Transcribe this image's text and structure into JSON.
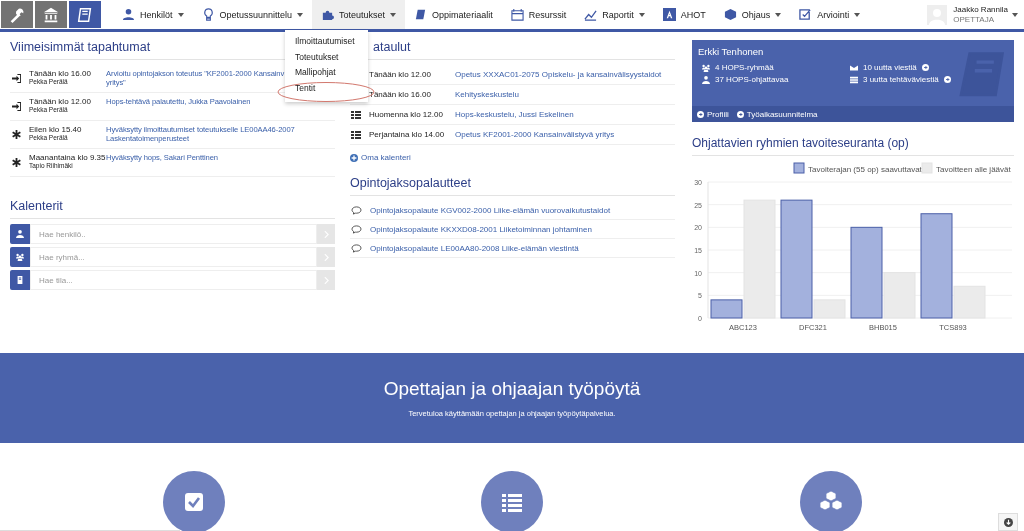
{
  "nav": {
    "logo_buttons": [
      {
        "selected": false
      },
      {
        "selected": false
      },
      {
        "selected": true
      }
    ],
    "items": [
      {
        "label": "Henkilöt",
        "caret": true,
        "selected": false
      },
      {
        "label": "Opetussuunnittelu",
        "caret": true,
        "selected": false
      },
      {
        "label": "Toteutukset",
        "caret": true,
        "selected": true
      },
      {
        "label": "Oppimateriaalit",
        "caret": false,
        "selected": false
      },
      {
        "label": "Resurssit",
        "caret": false,
        "selected": false
      },
      {
        "label": "Raportit",
        "caret": true,
        "selected": false
      },
      {
        "label": "AHOT",
        "caret": false,
        "selected": false
      },
      {
        "label": "Ohjaus",
        "caret": true,
        "selected": false
      },
      {
        "label": "Arviointi",
        "caret": true,
        "selected": false
      }
    ],
    "user": {
      "name": "Jaakko Rannila",
      "role": "OPETTAJA"
    }
  },
  "dropdown": {
    "items": [
      {
        "label": "Ilmoittautumiset",
        "highlighted": false
      },
      {
        "label": "Toteutukset",
        "highlighted": false
      },
      {
        "label": "Mallipohjat",
        "highlighted": false
      },
      {
        "label": "Tentit",
        "highlighted": true
      }
    ]
  },
  "events": {
    "title": "Viimeisimmät tapahtumat",
    "rows": [
      {
        "kind": "signin",
        "time": "Tänään klo 16.00",
        "person": "Pekka Perälä",
        "lines": [
          "Arvioitu opintojakson toteutus \"KF2001-2000 Kansainv",
          "yritys\""
        ]
      },
      {
        "kind": "signin",
        "time": "Tänään klo 12.00",
        "person": "Pekka Perälä",
        "lines": [
          "Hops-tehtävä palautettu, Jukka Paavolainen"
        ]
      },
      {
        "kind": "star",
        "time": "Eilen klo 15.40",
        "person": "Pekka Perälä",
        "lines": [
          "Hyväksytty ilmoittautumiset toteutukselle LE00AA46-2007",
          "Laskentatoimenperusteet"
        ]
      },
      {
        "kind": "star",
        "time": "Maanantaina klo 9.35",
        "person": "Tapio Riihimäki",
        "lines": [
          "Hyväksytty hops, Sakari Penttinen"
        ]
      }
    ]
  },
  "calendars": {
    "title": "Kalenterit",
    "searches": [
      {
        "placeholder": "Hae henkilö.."
      },
      {
        "placeholder": "Hae ryhmä..."
      },
      {
        "placeholder": "Hae tila..."
      }
    ]
  },
  "schedule": {
    "title": "ataulut",
    "rows": [
      {
        "kind": "covered",
        "time": "Tänään klo 12.00",
        "event": "Opetus XXXAC01-2075 Opiskelu- ja kansainvälisyystaidot"
      },
      {
        "kind": "covered",
        "time": "Tänään klo 16.00",
        "event": "Kehityskeskustelu"
      },
      {
        "kind": "listed",
        "time": "Huomenna klo 12.00",
        "event": "Hops-keskustelu, Jussi Eskelinen"
      },
      {
        "kind": "listed",
        "time": "Perjantaina klo 14.00",
        "event": "Opetus KF2001-2000 Kansainvälistyvä yritys"
      }
    ],
    "link": "Oma kalenteri"
  },
  "feedback": {
    "title": "Opintojaksopalautteet",
    "items": [
      "Opintojaksopalaute KGV002-2000 Liike-elämän vuorovaikutustaidot",
      "Opintojaksopalaute KKXXD08-2001 Liiketoiminnan johtaminen",
      "Opintojaksopalaute LE00AA80-2008 Liike-elämän viestintä"
    ]
  },
  "profile": {
    "name": "Erkki Tenhonen",
    "stats": [
      {
        "text": "4 HOPS-ryhmää",
        "link": false
      },
      {
        "text": "10 uutta viestiä",
        "link": true
      },
      {
        "text": "37 HOPS-ohjattavaa",
        "link": false
      },
      {
        "text": "3 uutta tehtäväviestiä",
        "link": true
      }
    ],
    "links": [
      "Profiili",
      "Työaikasuunnitelma"
    ]
  },
  "chart": {
    "title": "Ohjattavien ryhmien tavoiteseuranta (op)",
    "chart_data": {
      "type": "bar",
      "categories": [
        "ABC123",
        "DFC321",
        "BHB015",
        "TCS893"
      ],
      "series": [
        {
          "name": "Tavoiterajan (55 op) saavuttavat",
          "color": "#a3b1dd",
          "values": [
            4,
            26,
            20,
            23
          ]
        },
        {
          "name": "Tavoitteen alle jäävät",
          "color": "#ebebeb",
          "values": [
            26,
            4,
            10,
            7
          ]
        }
      ],
      "ylim": [
        0,
        30
      ],
      "yticks": [
        0,
        5,
        10,
        15,
        20,
        25,
        30
      ],
      "grid": true,
      "legend": true
    }
  },
  "banner": {
    "title": "Opettajan ja ohjaajan työpöytä",
    "subtitle": "Tervetuloa käyttämään opettajan ja ohjaajan työpöytäpalvelua."
  }
}
